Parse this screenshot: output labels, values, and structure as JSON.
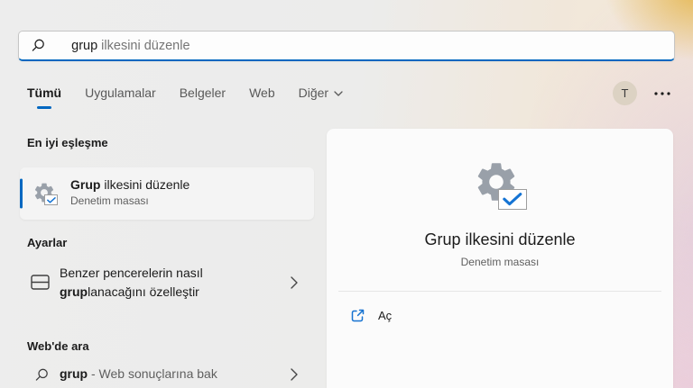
{
  "search": {
    "query": "grup",
    "suggestion": " ilkesini düzenle"
  },
  "tabs": [
    {
      "label": "Tümü",
      "active": true
    },
    {
      "label": "Uygulamalar",
      "active": false
    },
    {
      "label": "Belgeler",
      "active": false
    },
    {
      "label": "Web",
      "active": false
    },
    {
      "label": "Diğer",
      "active": false,
      "has_dropdown": true
    }
  ],
  "topbar": {
    "avatar_initial": "T"
  },
  "best_match": {
    "section_title": "En iyi eşleşme",
    "item": {
      "title_bold": "Grup",
      "title_rest": " ilkesini düzenle",
      "subtitle": "Denetim masası"
    }
  },
  "settings": {
    "section_title": "Ayarlar",
    "item": {
      "line1": "Benzer pencerelerin nasıl",
      "line2_bold": "grup",
      "line2_rest": "lanacağını özelleştir"
    }
  },
  "web_search": {
    "section_title": "Web'de ara",
    "item": {
      "query_bold": "grup",
      "rest": " - Web sonuçlarına bak"
    }
  },
  "preview": {
    "title": "Grup ilkesini düzenle",
    "subtitle": "Denetim masası",
    "open_label": "Aç"
  },
  "colors": {
    "accent_blue": "#0067c0",
    "check_blue": "#1574d4",
    "link_blue": "#1673d1",
    "gear_gray": "#99a0a9",
    "background_left": "#ececec",
    "background_right_warm": "#f7ecd8",
    "card_bg": "#fbfbfb"
  }
}
